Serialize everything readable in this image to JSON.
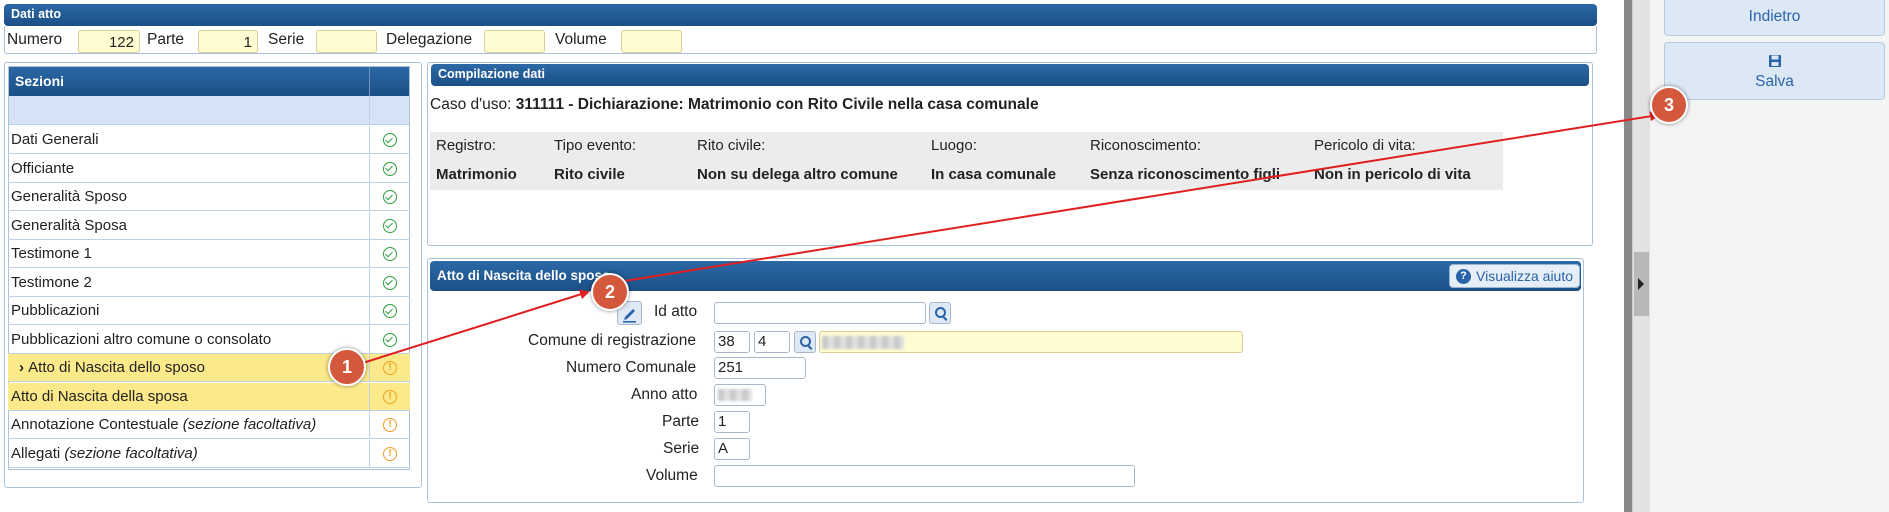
{
  "dati_atto": {
    "title": "Dati atto",
    "numero_label": "Numero",
    "numero_value": "122",
    "parte_label": "Parte",
    "parte_value": "1",
    "serie_label": "Serie",
    "serie_value": "",
    "delegazione_label": "Delegazione",
    "delegazione_value": "",
    "volume_label": "Volume",
    "volume_value": ""
  },
  "sezioni": {
    "title": "Sezioni",
    "items": [
      {
        "label": "Dati Generali",
        "note": "",
        "status": "ok",
        "current": false,
        "highlight": false
      },
      {
        "label": "Officiante",
        "note": "",
        "status": "ok",
        "current": false,
        "highlight": false
      },
      {
        "label": "Generalità Sposo",
        "note": "",
        "status": "ok",
        "current": false,
        "highlight": false
      },
      {
        "label": "Generalità Sposa",
        "note": "",
        "status": "ok",
        "current": false,
        "highlight": false
      },
      {
        "label": "Testimone 1",
        "note": "",
        "status": "ok",
        "current": false,
        "highlight": false
      },
      {
        "label": "Testimone 2",
        "note": "",
        "status": "ok",
        "current": false,
        "highlight": false
      },
      {
        "label": "Pubblicazioni",
        "note": "",
        "status": "ok",
        "current": false,
        "highlight": false
      },
      {
        "label": "Pubblicazioni altro comune o consolato",
        "note": "",
        "status": "ok",
        "current": false,
        "highlight": false
      },
      {
        "label": "Atto di Nascita dello sposo",
        "note": "",
        "status": "warning",
        "current": true,
        "highlight": true
      },
      {
        "label": "Atto di Nascita della sposa",
        "note": "",
        "status": "warning",
        "current": false,
        "highlight": true
      },
      {
        "label": "Annotazione Contestuale ",
        "note": "(sezione facoltativa)",
        "status": "warning",
        "current": false,
        "highlight": false
      },
      {
        "label": "Allegati ",
        "note": "(sezione facoltativa)",
        "status": "warning",
        "current": false,
        "highlight": false
      }
    ]
  },
  "compilazione": {
    "title": "Compilazione dati",
    "caso_label": "Caso d'uso: ",
    "caso_value": "311111 - Dichiarazione: Matrimonio con Rito Civile nella casa comunale",
    "headers": [
      "Registro:",
      "Tipo evento:",
      "Rito civile:",
      "Luogo:",
      "Riconoscimento:",
      "Pericolo di vita:"
    ],
    "values": [
      "Matrimonio",
      "Rito civile",
      "Non su delega altro comune",
      "In casa comunale",
      "Senza riconoscimento figli",
      "Non in pericolo di vita"
    ]
  },
  "atto_nascita": {
    "title": "Atto di Nascita dello sposo",
    "help_label": "Visualizza aiuto",
    "id_atto_label": "Id atto",
    "id_atto_value": "",
    "comune_label": "Comune di registrazione",
    "comune_code1": "38",
    "comune_code2": "4",
    "numero_comunale_label": "Numero Comunale",
    "numero_comunale_value": "251",
    "anno_label": "Anno atto",
    "parte_label": "Parte",
    "parte_value": "1",
    "serie_label": "Serie",
    "serie_value": "A",
    "volume_label": "Volume",
    "volume_value": ""
  },
  "actions": {
    "indietro_label": "Indietro",
    "salva_label": "Salva"
  },
  "annotations": [
    "1",
    "2",
    "3"
  ],
  "colors": {
    "header_blue": "#1b4f86",
    "highlight_yellow": "#fbe98a",
    "input_yellow": "#fffbd2",
    "ok_green": "#2e9e3e",
    "warn_orange": "#f0a020",
    "annotation_red": "#e02020",
    "badge_red": "#d4583c"
  }
}
